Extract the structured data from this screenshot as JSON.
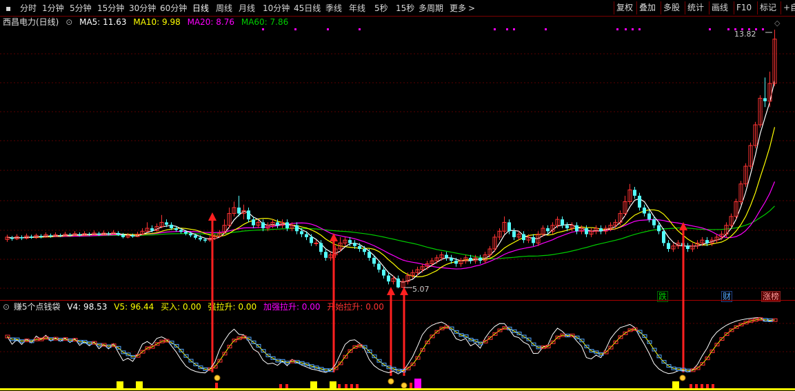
{
  "toolbar": {
    "periods": [
      "分时",
      "1分钟",
      "5分钟",
      "15分钟",
      "30分钟",
      "60分钟",
      "日线",
      "周线",
      "月线",
      "10分钟",
      "45日线",
      "季线",
      "年线",
      "5秒",
      "15秒",
      "多周期",
      "更多"
    ],
    "active_period": "日线",
    "buttons": [
      "复权",
      "叠加",
      "多股",
      "统计",
      "画线",
      "F10",
      "标记",
      "+自"
    ]
  },
  "main_chart": {
    "stock_title": "西昌电力(日线)",
    "ma5": "MA5: 11.63",
    "ma10": "MA10: 9.98",
    "ma20": "MA20: 8.76",
    "ma60": "MA60: 7.86",
    "high_label": "13.82",
    "low_label": "5.07",
    "tags": [
      "跌",
      "财",
      "涨榜"
    ],
    "colors": {
      "ma5": "#ffffff",
      "ma10": "#ffff00",
      "ma20": "#ff00ff",
      "ma60": "#00cc00",
      "up": "#ff3333",
      "down": "#54ffff"
    }
  },
  "indicator": {
    "name": "赚5个点钱袋",
    "v4": "V4: 98.53",
    "v5": "V5: 96.44",
    "buy": "买入: 0.00",
    "strong": "强拉升: 0.00",
    "add_strong": "加强拉升: 0.00",
    "start": "开始拉升: 0.00"
  }
}
